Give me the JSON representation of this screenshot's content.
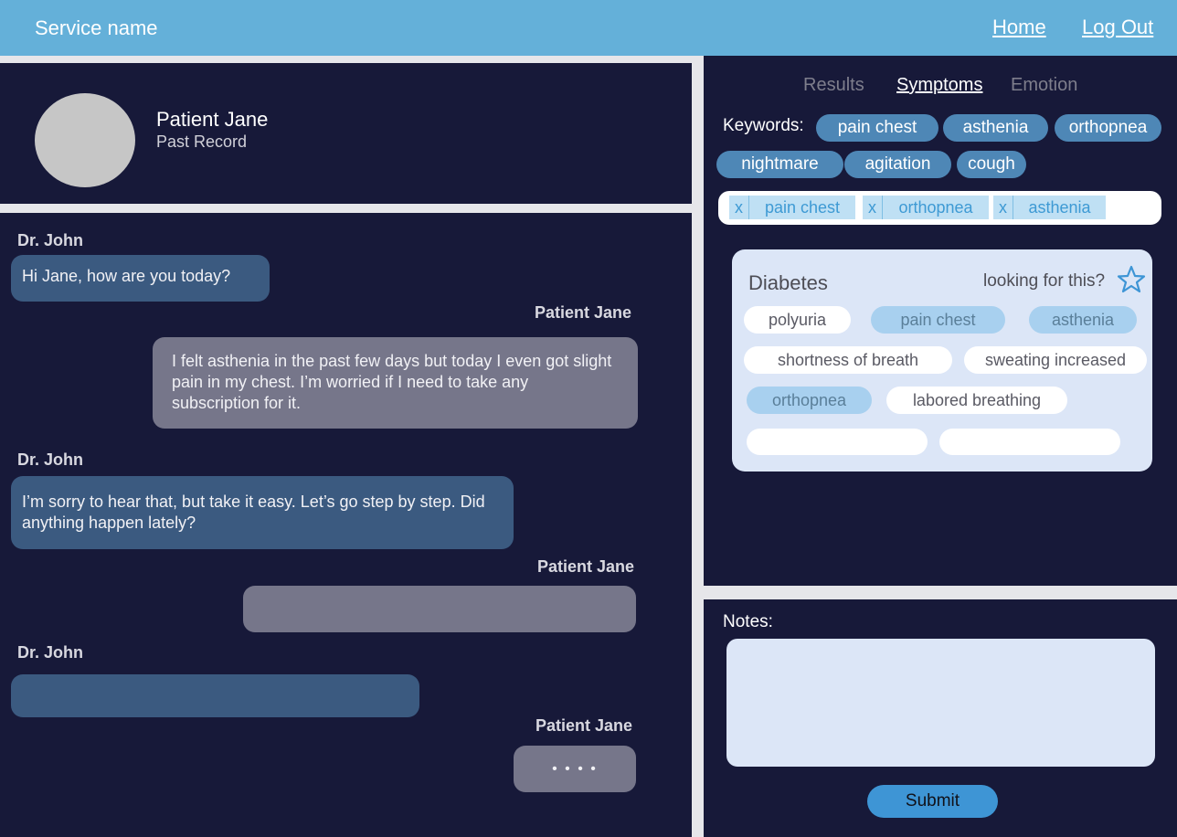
{
  "header": {
    "service_name": "Service name",
    "nav": {
      "home": "Home",
      "logout": "Log Out"
    }
  },
  "patient": {
    "name": "Patient Jane",
    "past_record_link": "Past Record"
  },
  "chat": {
    "messages": [
      {
        "sender": "Dr. John",
        "role": "doctor",
        "text": "Hi Jane, how are you today?"
      },
      {
        "sender": "Patient Jane",
        "role": "patient",
        "text": "I felt asthenia in the past few days but today I even got slight pain in my chest. I’m worried if I need to take any subscription for it."
      },
      {
        "sender": "Dr. John",
        "role": "doctor",
        "text": "I’m sorry to hear that, but take it easy. Let’s go step by step. Did anything happen lately?"
      },
      {
        "sender": "Patient Jane",
        "role": "patient",
        "text": ""
      },
      {
        "sender": "Dr. John",
        "role": "doctor",
        "text": ""
      },
      {
        "sender": "Patient Jane",
        "role": "patient",
        "text": "",
        "typing_indicator": "• • • •"
      }
    ]
  },
  "tabs": [
    {
      "label": "Results",
      "active": false
    },
    {
      "label": "Symptoms",
      "active": true
    },
    {
      "label": "Emotion",
      "active": false
    }
  ],
  "keywords": {
    "label": "Keywords:",
    "items": [
      "pain chest",
      "asthenia",
      "orthopnea",
      "nightmare",
      "agitation",
      "cough"
    ]
  },
  "selected_keywords": {
    "remove_label": "x",
    "items": [
      "pain chest",
      "orthopnea",
      "asthenia"
    ]
  },
  "suggestion": {
    "condition": "Diabetes",
    "prompt": "looking for this?",
    "favorite_icon": "star-outline-icon",
    "symptoms": [
      {
        "label": "polyuria",
        "matched": false
      },
      {
        "label": "pain chest",
        "matched": true
      },
      {
        "label": "asthenia",
        "matched": true
      },
      {
        "label": "shortness of breath",
        "matched": false
      },
      {
        "label": "sweating increased",
        "matched": false
      },
      {
        "label": "orthopnea",
        "matched": true
      },
      {
        "label": "labored breathing",
        "matched": false
      },
      {
        "label": "",
        "matched": false
      },
      {
        "label": "",
        "matched": false
      }
    ]
  },
  "notes": {
    "label": "Notes:",
    "value": "",
    "submit_label": "Submit"
  },
  "colors": {
    "header": "#64b0d9",
    "panel": "#171939",
    "doctor_bubble": "#3b5a80",
    "patient_bubble": "#76768a",
    "keyword_chip": "#4e87b6",
    "card": "#dce6f7",
    "matched_symptom": "#a8d0ef",
    "submit": "#3e95d5"
  }
}
